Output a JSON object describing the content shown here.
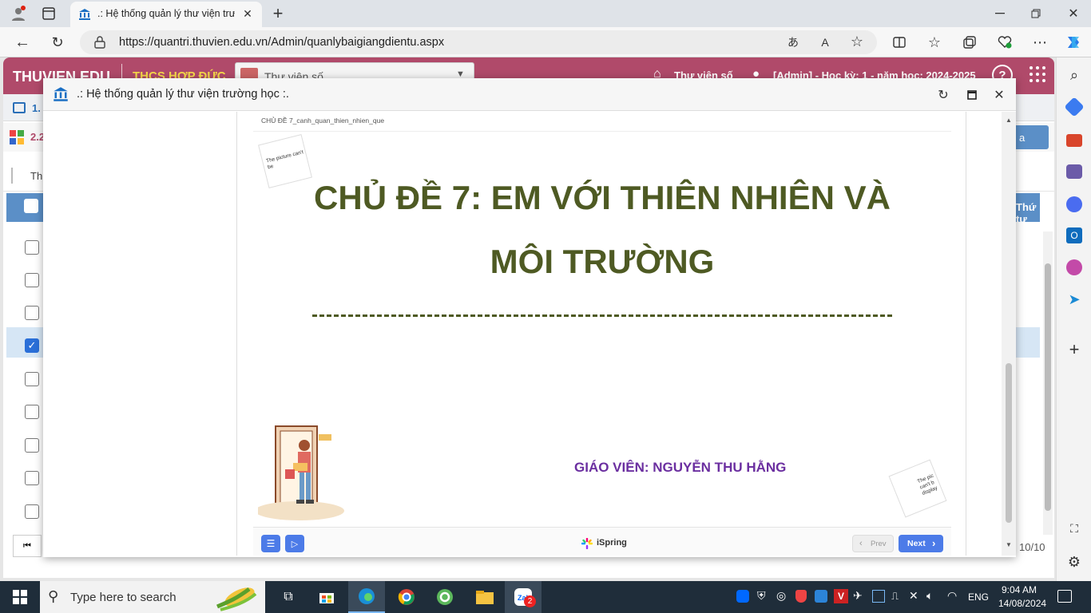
{
  "browser": {
    "tab_title": ".: Hệ thống quản lý thư viện trườ",
    "url": "https://quantri.thuvien.edu.vn/Admin/quanlybaigiangdientu.aspx",
    "new_tab": "+"
  },
  "app": {
    "brand": "THUVIEN.EDU",
    "school": "THCS HỢP ĐỨC",
    "select_value": "Thư viện số",
    "nav_home": "Thư viện số",
    "user_info": "[Admin] - Học kỳ: 1 - năm học: 2024-2025",
    "help": "?",
    "row1_label": "1.",
    "row2_label": "2.2",
    "filter_label": "Th",
    "right_button": "a",
    "col_header_right": "Thứ tự",
    "pager": "10/10"
  },
  "modal": {
    "title": ".: Hệ thống quản lý thư viện trường học :.",
    "file_name": "CHỦ ĐỀ 7_canh_quan_thien_nhien_que",
    "broken_img_1": "The picture can't be",
    "broken_img_2": "The pic can't b display",
    "slide_title_1": "CHỦ ĐỀ 7: EM VỚI THIÊN NHIÊN VÀ",
    "slide_title_2": "MÔI TRƯỜNG",
    "teacher": "GIÁO VIÊN: NGUYỄN THU HẰNG",
    "brand": "iSpring",
    "prev": "Prev",
    "next": "Next"
  },
  "taskbar": {
    "search_placeholder": "Type here to search",
    "lang": "ENG",
    "time": "9:04 AM",
    "date": "14/08/2024",
    "zalo_badge": "2"
  },
  "colors": {
    "header": "#b04a6a",
    "slide_title": "#4e5a23",
    "teacher": "#6b2fa0",
    "button": "#4c7be8"
  }
}
